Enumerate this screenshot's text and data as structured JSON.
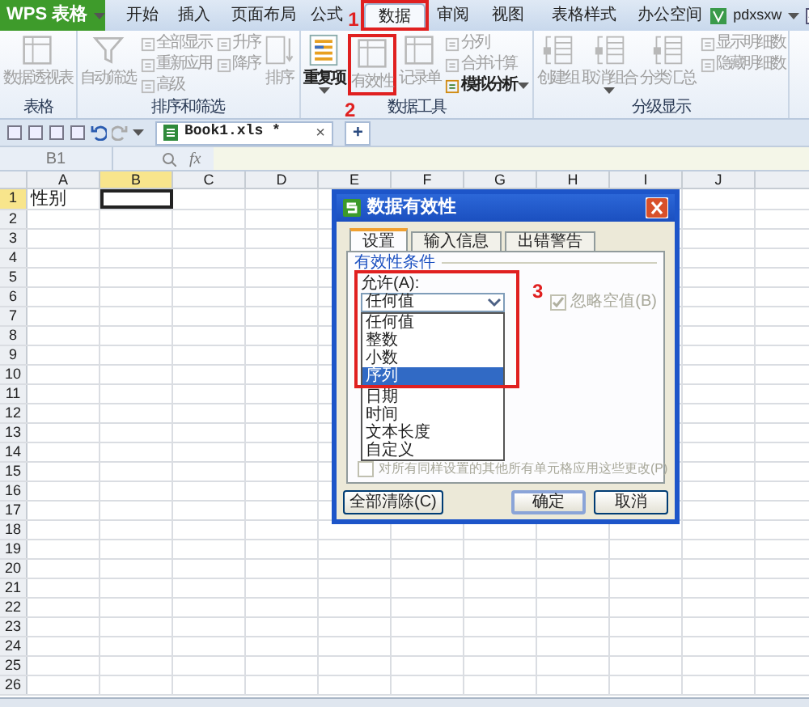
{
  "app_button": {
    "label": "WPS 表格"
  },
  "menu_tabs": [
    {
      "label": "开始",
      "selected": false
    },
    {
      "label": "插入",
      "selected": false
    },
    {
      "label": "页面布局",
      "selected": false
    },
    {
      "label": "公式",
      "selected": false
    },
    {
      "label": "数据",
      "selected": true
    },
    {
      "label": "审阅",
      "selected": false
    },
    {
      "label": "视图",
      "selected": false
    },
    {
      "label": "表格样式",
      "selected": false
    },
    {
      "label": "办公空间",
      "selected": false
    }
  ],
  "user": {
    "name": "pdxsxw"
  },
  "ribbon_groups": [
    {
      "label": "表格",
      "items": [
        {
          "kind": "large",
          "label": "数据透视表",
          "disabled": true,
          "caret": false
        }
      ]
    },
    {
      "label": "排序和筛选",
      "items": [
        {
          "kind": "large",
          "label": "自动筛选",
          "disabled": true,
          "caret": false
        },
        {
          "kind": "stack",
          "items": [
            {
              "label": "全部显示",
              "disabled": true,
              "caret": false
            },
            {
              "label": "重新应用",
              "disabled": true,
              "caret": false
            },
            {
              "label": "高级",
              "disabled": true,
              "caret": false
            }
          ]
        },
        {
          "kind": "stack",
          "items": [
            {
              "label": "升序",
              "disabled": true,
              "caret": false
            },
            {
              "label": "降序",
              "disabled": true,
              "caret": false
            }
          ]
        },
        {
          "kind": "large",
          "label": "排序",
          "disabled": true,
          "caret": false
        }
      ]
    },
    {
      "label": "数据工具",
      "items": [
        {
          "kind": "large",
          "label": "重复项",
          "disabled": false,
          "caret": true
        },
        {
          "kind": "large",
          "label": "有效性",
          "disabled": true,
          "caret": false
        },
        {
          "kind": "large",
          "label": "记录单",
          "disabled": true,
          "caret": false
        },
        {
          "kind": "stack",
          "items": [
            {
              "label": "分列",
              "disabled": true,
              "caret": false
            },
            {
              "label": "合并计算",
              "disabled": true,
              "caret": false
            },
            {
              "label": "模拟分析",
              "disabled": false,
              "caret": true
            }
          ]
        }
      ]
    },
    {
      "label": "分级显示",
      "items": [
        {
          "kind": "large",
          "label": "创建组",
          "disabled": true,
          "caret": false
        },
        {
          "kind": "large",
          "label": "取消组合",
          "disabled": true,
          "caret": true
        },
        {
          "kind": "large",
          "label": "分类汇总",
          "disabled": true,
          "caret": false
        },
        {
          "kind": "stack",
          "items": [
            {
              "label": "显示明细数",
              "disabled": true,
              "caret": false
            },
            {
              "label": "隐藏明细数",
              "disabled": true,
              "caret": false
            }
          ]
        }
      ]
    }
  ],
  "document_tab": {
    "title": "Book1.xls *",
    "close": "×",
    "new_tab": "+"
  },
  "formula_bar": {
    "name_box": "B1",
    "function_label": "fx"
  },
  "sheet": {
    "columns": [
      {
        "label": "A",
        "selected": false
      },
      {
        "label": "B",
        "selected": true
      },
      {
        "label": "C",
        "selected": false
      },
      {
        "label": "D",
        "selected": false
      },
      {
        "label": "E",
        "selected": false
      },
      {
        "label": "F",
        "selected": false
      },
      {
        "label": "G",
        "selected": false
      },
      {
        "label": "H",
        "selected": false
      },
      {
        "label": "I",
        "selected": false
      },
      {
        "label": "J",
        "selected": false
      }
    ],
    "rows": [
      {
        "label": "1",
        "selected": true,
        "cells": [
          {
            "text": "性别",
            "selected": false
          },
          {
            "selected": true
          }
        ]
      },
      {
        "label": "2",
        "selected": false
      },
      {
        "label": "3",
        "selected": false
      },
      {
        "label": "4",
        "selected": false
      },
      {
        "label": "5",
        "selected": false
      },
      {
        "label": "6",
        "selected": false
      },
      {
        "label": "7",
        "selected": false
      },
      {
        "label": "8",
        "selected": false
      },
      {
        "label": "9",
        "selected": false
      },
      {
        "label": "10",
        "selected": false
      },
      {
        "label": "11",
        "selected": false
      },
      {
        "label": "12",
        "selected": false
      },
      {
        "label": "13",
        "selected": false
      },
      {
        "label": "14",
        "selected": false
      },
      {
        "label": "15",
        "selected": false
      },
      {
        "label": "16",
        "selected": false
      },
      {
        "label": "17",
        "selected": false
      },
      {
        "label": "18",
        "selected": false
      },
      {
        "label": "19",
        "selected": false
      },
      {
        "label": "20",
        "selected": false
      },
      {
        "label": "21",
        "selected": false
      },
      {
        "label": "22",
        "selected": false
      },
      {
        "label": "23",
        "selected": false
      },
      {
        "label": "24",
        "selected": false
      },
      {
        "label": "25",
        "selected": false
      },
      {
        "label": "26",
        "selected": false
      }
    ]
  },
  "dialog": {
    "title": "数据有效性",
    "tabs": [
      {
        "label": "设置",
        "selected": true
      },
      {
        "label": "输入信息",
        "selected": false
      },
      {
        "label": "出错警告",
        "selected": false
      }
    ],
    "section": "有效性条件",
    "allow_label": "允许(A):",
    "allow_value": "任何值",
    "allow_options": [
      {
        "label": "任何值",
        "selected": false
      },
      {
        "label": "整数",
        "selected": false
      },
      {
        "label": "小数",
        "selected": false
      },
      {
        "label": "序列",
        "selected": true
      },
      {
        "label": "日期",
        "selected": false
      },
      {
        "label": "时间",
        "selected": false
      },
      {
        "label": "文本长度",
        "selected": false
      },
      {
        "label": "自定义",
        "selected": false
      }
    ],
    "ignore_blank": {
      "label": "忽略空值(B)",
      "checked": true,
      "disabled": true
    },
    "apply_all": {
      "label": "对所有同样设置的其他所有单元格应用这些更改(P)",
      "checked": false,
      "disabled": true
    },
    "buttons": [
      {
        "label": "全部清除(C)",
        "default": false
      },
      {
        "label": "确定",
        "default": true
      },
      {
        "label": "取消",
        "default": false
      }
    ]
  },
  "annotations": [
    {
      "label": "1"
    },
    {
      "label": "2"
    },
    {
      "label": "3"
    }
  ]
}
